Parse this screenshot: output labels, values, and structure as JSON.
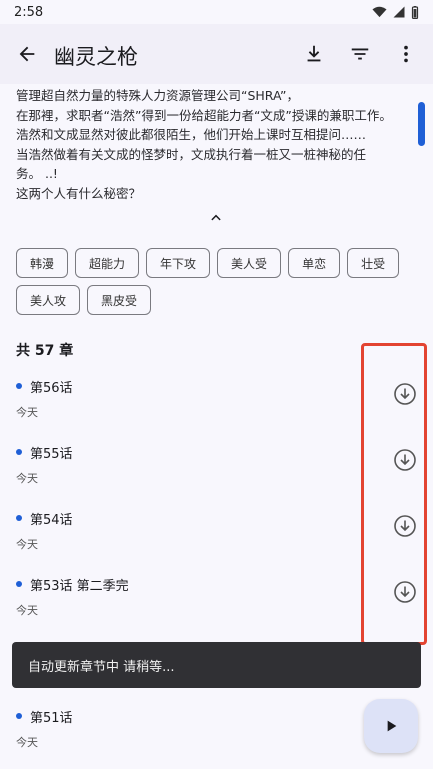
{
  "status_bar": {
    "time": "2:58"
  },
  "app_bar": {
    "title": "幽灵之枪"
  },
  "description": {
    "lines": [
      "管理超自然力量的特殊人力资源管理公司“SHRA”，",
      "在那裡，求职者“浩然”得到一份给超能力者“文成”授课的兼职工作。",
      "浩然和文成显然对彼此都很陌生，他们开始上课时互相提问……",
      "当浩然做着有关文成的怪梦时，文成执行着一桩又一桩神秘的任",
      "务。 ..!",
      "这两个人有什么秘密？"
    ]
  },
  "tags": [
    "韩漫",
    "超能力",
    "年下攻",
    "美人受",
    "单恋",
    "壮受",
    "美人攻",
    "黑皮受"
  ],
  "chapter_count": "共 57 章",
  "chapters": [
    {
      "title": "第56话",
      "date": "今天"
    },
    {
      "title": "第55话",
      "date": "今天"
    },
    {
      "title": "第54话",
      "date": "今天"
    },
    {
      "title": "第53话 第二季完",
      "date": "今天"
    },
    {
      "title": "第51话",
      "date": "今天"
    }
  ],
  "snackbar": {
    "message": "自动更新章节中 请稍等..."
  },
  "colors": {
    "accent": "#1f5fd6",
    "highlight": "#e34432",
    "snackbar": "#303034"
  }
}
